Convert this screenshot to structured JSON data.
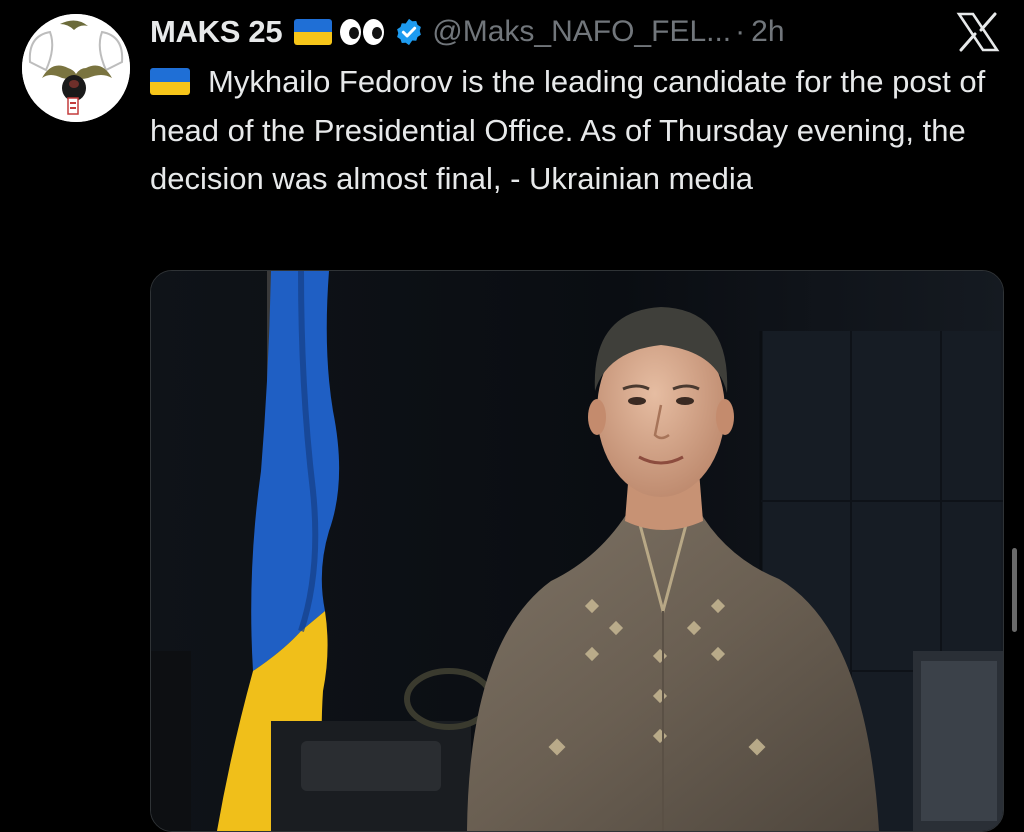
{
  "tweet": {
    "author": {
      "display_name": "MAKS 25",
      "handle": "@Maks_NAFO_FEL...",
      "verified": true,
      "emojis": [
        "ukraine-flag",
        "eyes"
      ]
    },
    "separator": "·",
    "time": "2h",
    "platform_icon": "x-logo-icon",
    "text": "Mykhailo Fedorov is the leading candidate for the post of head of the Presidential Office. As of Thursday evening, the decision was almost final, - Ukrainian media",
    "text_prefix_emoji": "ukraine-flag",
    "media": {
      "type": "photo",
      "subject": "man in embroidered shirt beside Ukrainian flag"
    }
  },
  "colors": {
    "background": "#000000",
    "text_primary": "#e7e9ea",
    "text_secondary": "#71767b",
    "verified_blue": "#1d9bf0",
    "flag_blue": "#1f6fd6",
    "flag_yellow": "#f6c519"
  }
}
